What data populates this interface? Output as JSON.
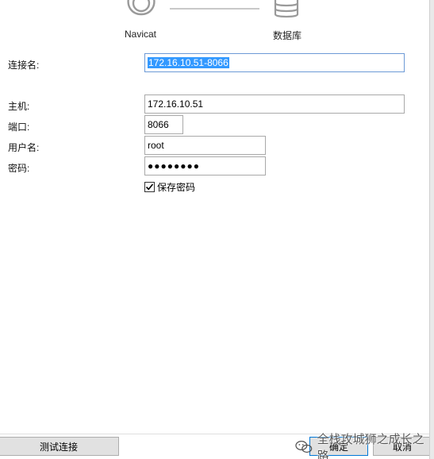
{
  "diagram": {
    "source_label": "Navicat",
    "target_label": "数据库"
  },
  "form": {
    "connection_name": {
      "label": "连接名:",
      "value": "172.16.10.51-8066"
    },
    "host": {
      "label": "主机:",
      "value": "172.16.10.51"
    },
    "port": {
      "label": "端口:",
      "value": "8066"
    },
    "username": {
      "label": "用户名:",
      "value": "root"
    },
    "password": {
      "label": "密码:",
      "value": "●●●●●●●●"
    },
    "save_password": {
      "label": "保存密码",
      "checked": true
    }
  },
  "buttons": {
    "test": "测试连接",
    "ok": "确定",
    "cancel": "取消"
  },
  "watermark": {
    "text": "全栈攻城狮之成长之路"
  },
  "icons": {
    "navicat": "navicat-client-icon",
    "database": "database-icon",
    "checkbox": "checkmark-icon",
    "watermark": "wechat-icon"
  }
}
